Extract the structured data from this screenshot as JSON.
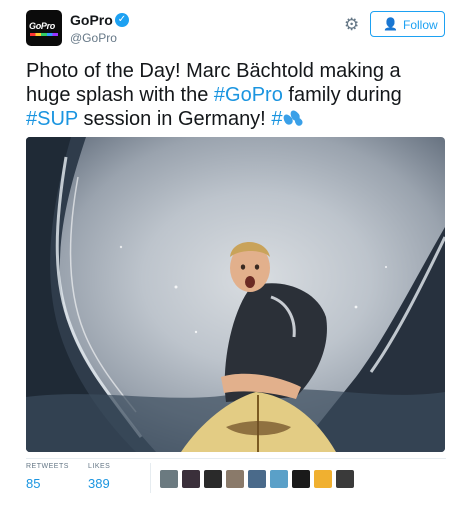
{
  "account": {
    "name": "GoPro",
    "handle": "@GoPro",
    "avatar_text": "GoPro",
    "verified_icon": "verified-badge-icon"
  },
  "header": {
    "gear_icon": "gear-icon",
    "follow_label": "Follow",
    "follow_icon": "add-user-icon"
  },
  "tweet": {
    "text_part1": "Photo of the Day! Marc Bächtold making a huge splash with the ",
    "hashtag1": "#GoPro",
    "text_part2": " family during ",
    "hashtag2": "#SUP",
    "text_part3": " session in Germany! ",
    "hashtag3": "#",
    "emoji": "splashing-sweat-emoji"
  },
  "stats": {
    "retweets_label": "RETWEETS",
    "retweets_value": "85",
    "likes_label": "LIKES",
    "likes_value": "389"
  },
  "likers": {
    "colors": [
      "#6b7a80",
      "#3a2f3a",
      "#2a2a2a",
      "#8a7a6a",
      "#4a6a8a",
      "#5aa0c8",
      "#1a1a1a",
      "#f0b030",
      "#3a3a3a"
    ]
  }
}
